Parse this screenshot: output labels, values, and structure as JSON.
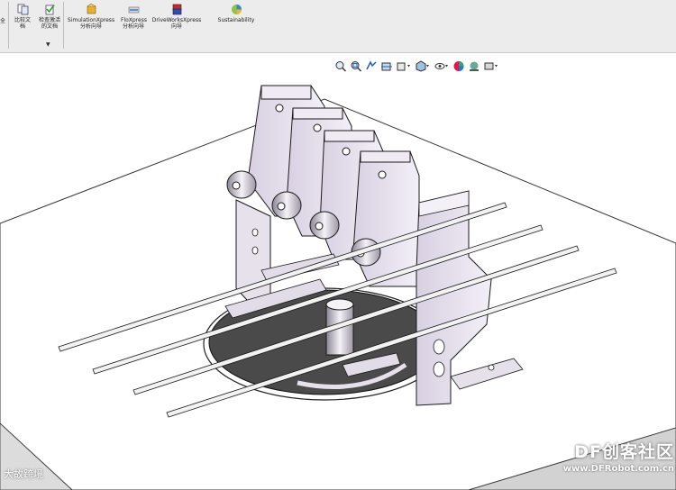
{
  "ribbon": {
    "cut_label": "全",
    "compare_docs": "比较文档",
    "check_docs": "检查激活的文档",
    "simulation": "SimulationXpress 分析向导",
    "flo": "FloXpress 分析向导",
    "driveworks": "DriveWorksXpress 向导",
    "sustainability": "Sustainability"
  },
  "viewport_toolbar": {
    "icons": [
      "zoom-to-fit-icon",
      "zoom-area-icon",
      "previous-view-icon",
      "section-view-icon",
      "view-orientation-icon",
      "display-style-icon",
      "hide-show-icon",
      "edit-appearance-icon",
      "apply-scene-icon",
      "view-settings-icon"
    ]
  },
  "watermarks": {
    "left": "大故跨境",
    "right_title": "DF创客社区",
    "right_url": "www.DFRobot.com.cn"
  }
}
